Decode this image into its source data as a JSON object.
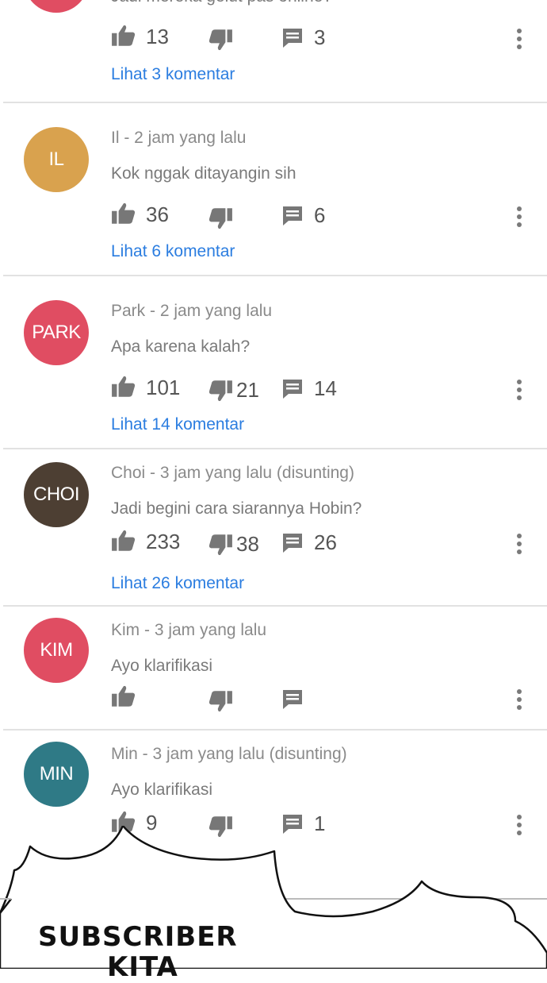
{
  "colors": {
    "avatar_red": "#e04d62",
    "avatar_gold": "#d9a24e",
    "avatar_brown": "#4d3f33",
    "avatar_teal": "#2f7a86",
    "link_blue": "#2b7de0"
  },
  "comments": [
    {
      "author_line": "Jadi mereka gelut pas online?",
      "likes": "13",
      "dislikes": "",
      "replies": "3",
      "view_replies": "Lihat 3 komentar"
    },
    {
      "avatar": "IL",
      "author_line": "Il - 2 jam yang lalu",
      "text": "Kok nggak ditayangin sih",
      "likes": "36",
      "dislikes": "",
      "replies": "6",
      "view_replies": "Lihat 6 komentar"
    },
    {
      "avatar": "PARK",
      "author_line": "Park - 2 jam yang lalu",
      "text": "Apa karena kalah?",
      "likes": "101",
      "dislikes": "21",
      "replies": "14",
      "view_replies": "Lihat 14 komentar"
    },
    {
      "avatar": "CHOI",
      "author_line": "Choi - 3 jam yang lalu (disunting)",
      "text": "Jadi begini cara siarannya Hobin?",
      "likes": "233",
      "dislikes": "38",
      "replies": "26",
      "view_replies": "Lihat 26 komentar"
    },
    {
      "avatar": "KIM",
      "author_line": "Kim - 3 jam yang lalu",
      "text": "Ayo klarifikasi",
      "likes": "",
      "dislikes": "",
      "replies": ""
    },
    {
      "avatar": "MIN",
      "author_line": "Min - 3 jam yang lalu (disunting)",
      "text": "Ayo klarifikasi",
      "likes": "9",
      "dislikes": "",
      "replies": "1"
    }
  ],
  "overlay_caption": {
    "line1": "SUBSCRIBER",
    "line2": "KITA"
  }
}
